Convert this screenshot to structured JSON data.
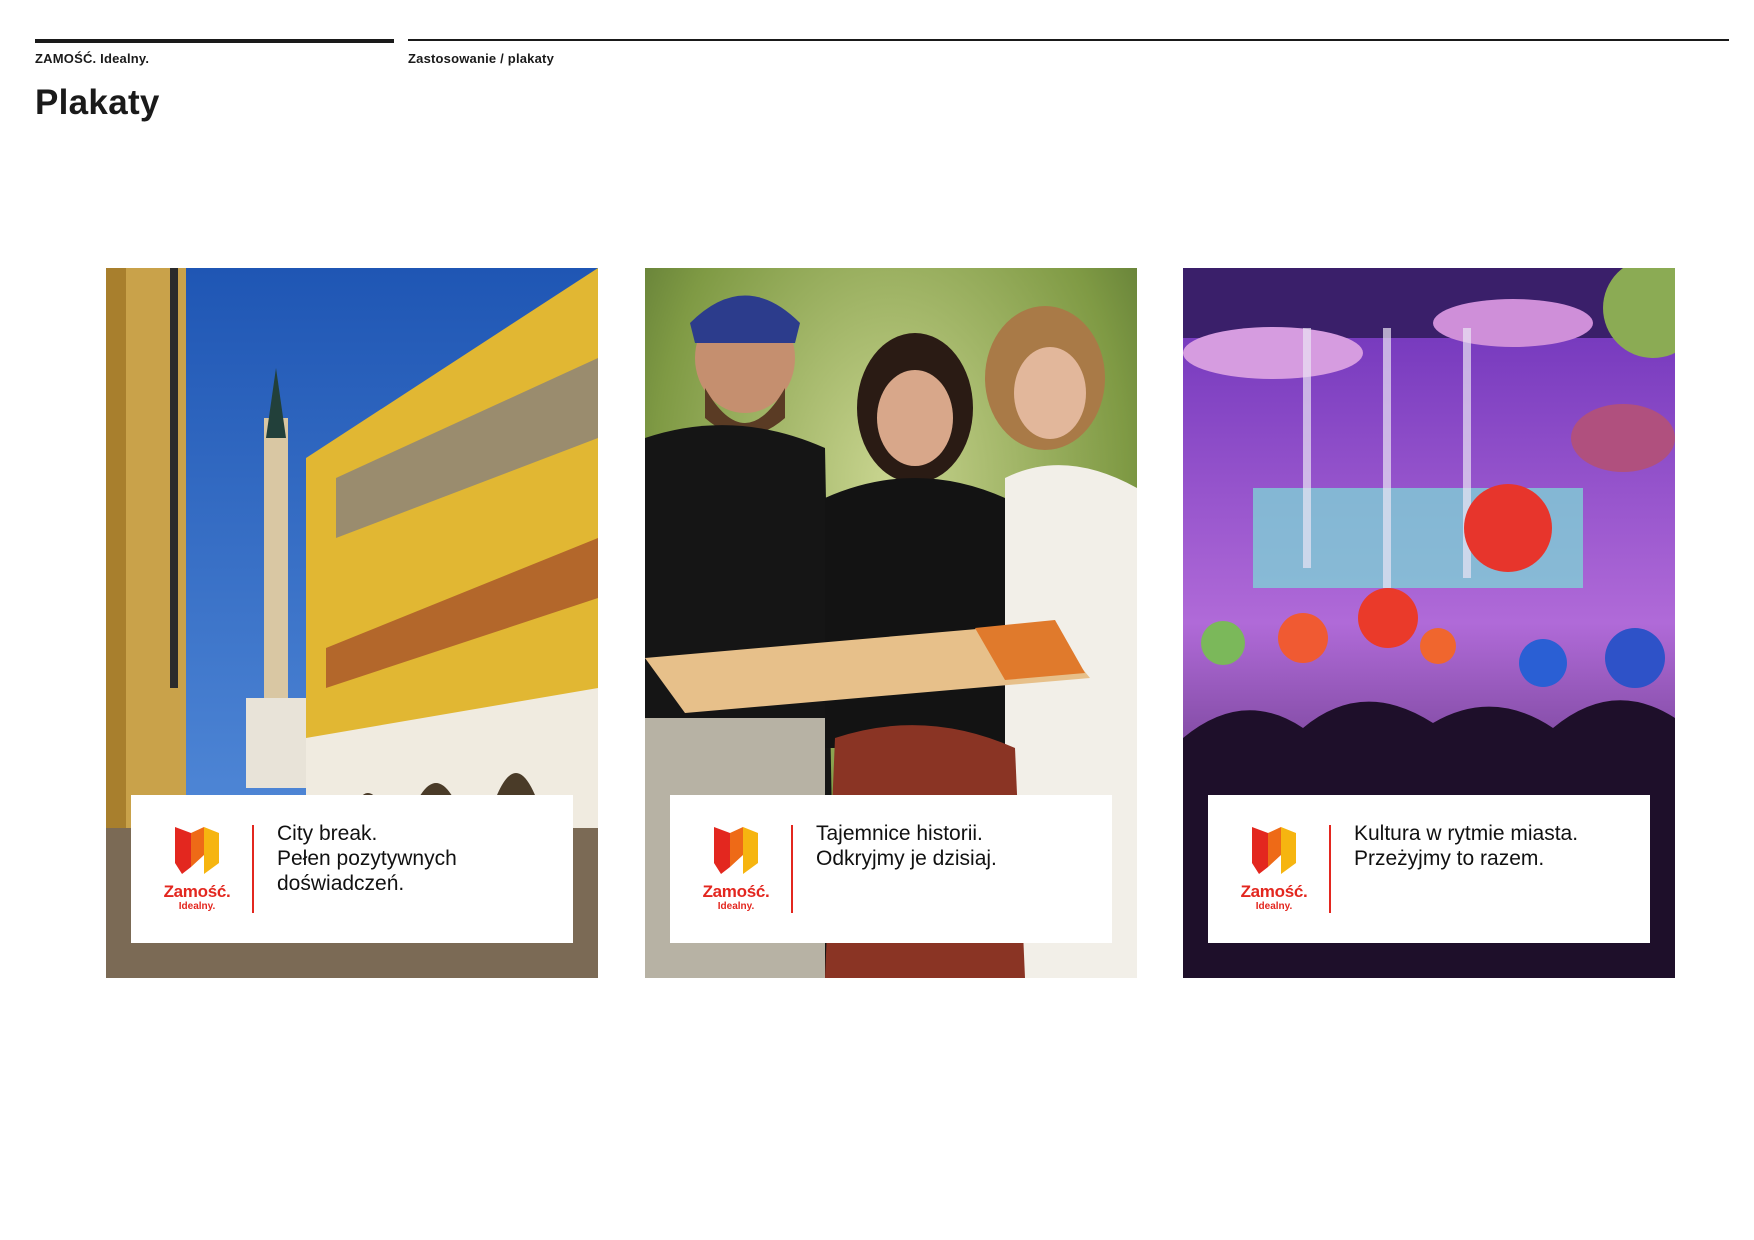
{
  "header": {
    "brand": "ZAMOŚĆ. Idealny.",
    "section": "Zastosowanie / plakaty",
    "title": "Plakaty"
  },
  "logo": {
    "wordmark": "Zamość.",
    "tagline": "Idealny."
  },
  "colors": {
    "brand_red": "#e3271f",
    "brand_yellow": "#f6b510",
    "brand_orange": "#ee6a17",
    "text": "#1a1a1a"
  },
  "posters": [
    {
      "photo": "zamosc-old-town-arcades-and-town-hall",
      "lines": [
        "City break.",
        "Pełen pozytywnych",
        "doświadczeń."
      ]
    },
    {
      "photo": "three-young-tourists-reading-map",
      "lines": [
        "Tajemnice historii.",
        "Odkryjmy je dzisiaj."
      ]
    },
    {
      "photo": "concert-stage-with-balloons-and-crowd",
      "lines": [
        "Kultura w rytmie miasta.",
        "Przeżyjmy to razem."
      ]
    }
  ]
}
